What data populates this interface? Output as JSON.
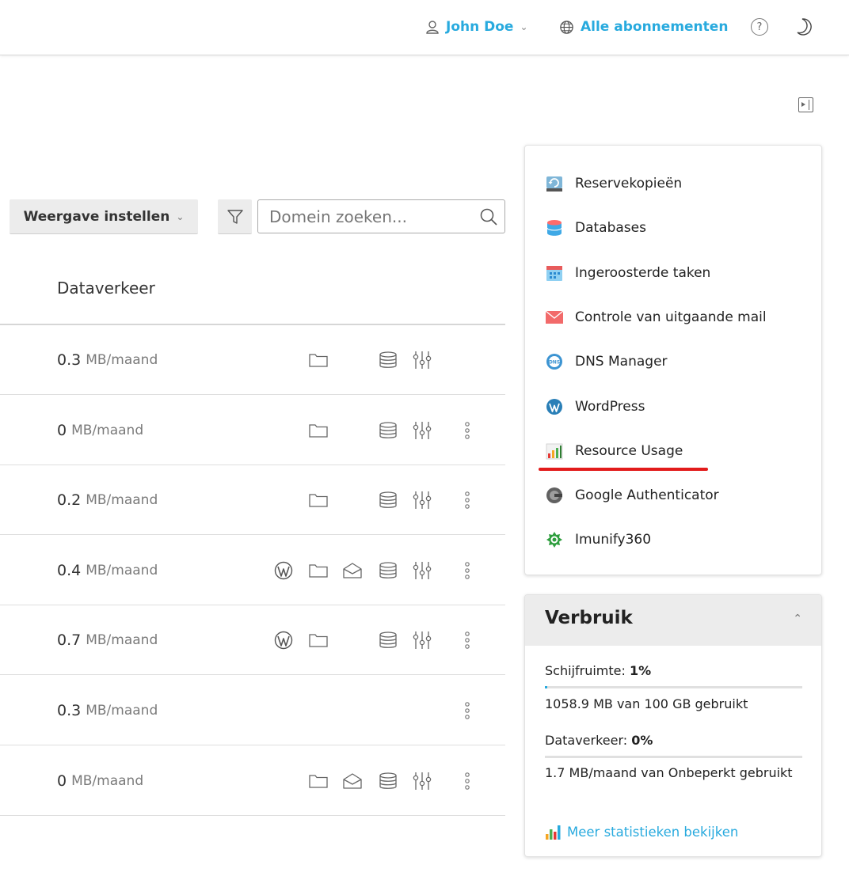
{
  "header": {
    "user_name": "John Doe",
    "subscriptions_label": "Alle abonnementen",
    "help_label": "?"
  },
  "toolbar": {
    "view_settings_label": "Weergave instellen",
    "search_placeholder": "Domein zoeken..."
  },
  "table": {
    "column_header": "Dataverkeer",
    "unit": "MB/maand",
    "rows": [
      {
        "traffic": "0.3",
        "icons": [
          "folder-icon",
          "database-icon",
          "settings-sliders-icon"
        ]
      },
      {
        "traffic": "0",
        "icons": [
          "folder-icon",
          "database-icon",
          "settings-sliders-icon",
          "more-options-icon"
        ]
      },
      {
        "traffic": "0.2",
        "icons": [
          "folder-icon",
          "database-icon",
          "settings-sliders-icon",
          "more-options-icon"
        ]
      },
      {
        "traffic": "0.4",
        "icons": [
          "wordpress-icon",
          "folder-icon",
          "mail-icon",
          "database-icon",
          "settings-sliders-icon",
          "more-options-icon"
        ]
      },
      {
        "traffic": "0.7",
        "icons": [
          "wordpress-icon",
          "folder-icon",
          "database-icon",
          "settings-sliders-icon",
          "more-options-icon"
        ]
      },
      {
        "traffic": "0.3",
        "icons": [
          "more-options-icon"
        ]
      },
      {
        "traffic": "0",
        "icons": [
          "folder-icon",
          "mail-icon",
          "database-icon",
          "settings-sliders-icon",
          "more-options-icon"
        ]
      }
    ]
  },
  "tools": {
    "items": [
      {
        "label": "Reservekopieën",
        "icon": "backup-icon"
      },
      {
        "label": "Databases",
        "icon": "database-icon"
      },
      {
        "label": "Ingeroosterde taken",
        "icon": "calendar-icon"
      },
      {
        "label": "Controle van uitgaande mail",
        "icon": "envelope-icon"
      },
      {
        "label": "DNS Manager",
        "icon": "dns-icon"
      },
      {
        "label": "WordPress",
        "icon": "wordpress-icon"
      },
      {
        "label": "Resource Usage",
        "icon": "bar-chart-icon"
      },
      {
        "label": "Google Authenticator",
        "icon": "authenticator-icon"
      },
      {
        "label": "Imunify360",
        "icon": "imunify-icon"
      }
    ]
  },
  "usage": {
    "title": "Verbruik",
    "disk_label": "Schijfruimte:",
    "disk_percent": "1%",
    "disk_fraction": 0.01,
    "disk_detail": "1058.9 MB van 100 GB gebruikt",
    "traffic_label": "Dataverkeer:",
    "traffic_percent": "0%",
    "traffic_fraction": 0,
    "traffic_detail": "1.7 MB/maand van Onbeperkt gebruikt",
    "more_stats_label": "Meer statistieken bekijken"
  },
  "colors": {
    "accent": "#28aade",
    "highlight_underline": "#e21b1b"
  }
}
